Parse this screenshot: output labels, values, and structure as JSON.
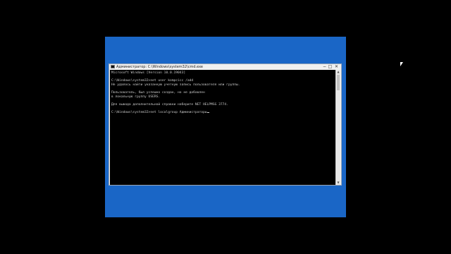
{
  "window": {
    "title": "Администратор: C:\\Windows\\system32\\cmd.exe",
    "minimize_glyph": "−",
    "maximize_glyph": "□",
    "close_glyph": "✕",
    "icon": "cmd-icon"
  },
  "console": {
    "lines": [
      "Microsoft Windows [Version 10.0.19043]",
      "",
      "C:\\Windows\\system32>net user kompcicc /add",
      "Не удалось найти указанную учетную запись пользователя или группы.",
      "",
      "Пользователь, был успешно создан, но не добавлен",
      "в локальную группу USERS.",
      "",
      "Для вывода дополнительной справки наберите NET HELPMSG 3774.",
      "",
      "C:\\Windows\\system32>net localgroup Администраторы"
    ]
  },
  "scrollbar": {
    "up_glyph": "▲",
    "down_glyph": "▼"
  },
  "colors": {
    "desktop": "#1a66c6",
    "console_bg": "#000000",
    "console_text": "#c8c8c8"
  }
}
